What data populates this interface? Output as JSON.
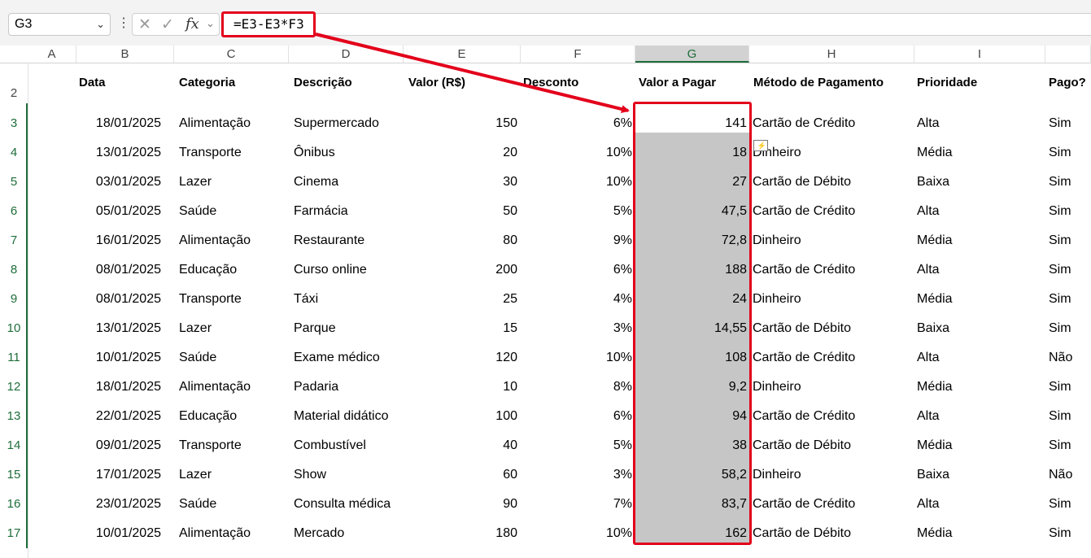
{
  "formula_bar": {
    "name_box": "G3",
    "name_box_dropdown": "⌄",
    "dots": "⋮",
    "cancel_icon": "✕",
    "enter_icon": "✓",
    "fx_label": "fx",
    "fx_dropdown": "⌄",
    "formula": "=E3-E3*F3",
    "highlight_color": "#e3001b"
  },
  "column_headers": [
    "A",
    "B",
    "C",
    "D",
    "E",
    "F",
    "G",
    "H",
    "I"
  ],
  "selected_column": "G",
  "row_numbers": [
    "2",
    "3",
    "4",
    "5",
    "6",
    "7",
    "8",
    "9",
    "10",
    "11",
    "12",
    "13",
    "14",
    "15",
    "16",
    "17"
  ],
  "table": {
    "headers": [
      "Data",
      "Categoria",
      "Descrição",
      "Valor (R$)",
      "Desconto",
      "Valor a Pagar",
      "Método de Pagamento",
      "Prioridade",
      "Pago?"
    ],
    "rows": [
      [
        "18/01/2025",
        "Alimentação",
        "Supermercado",
        "150",
        "6%",
        "141",
        "Cartão de Crédito",
        "Alta",
        "Sim"
      ],
      [
        "13/01/2025",
        "Transporte",
        "Ônibus",
        "20",
        "10%",
        "18",
        "Dinheiro",
        "Média",
        "Sim"
      ],
      [
        "03/01/2025",
        "Lazer",
        "Cinema",
        "30",
        "10%",
        "27",
        "Cartão de Débito",
        "Baixa",
        "Sim"
      ],
      [
        "05/01/2025",
        "Saúde",
        "Farmácia",
        "50",
        "5%",
        "47,5",
        "Cartão de Crédito",
        "Alta",
        "Sim"
      ],
      [
        "16/01/2025",
        "Alimentação",
        "Restaurante",
        "80",
        "9%",
        "72,8",
        "Dinheiro",
        "Média",
        "Sim"
      ],
      [
        "08/01/2025",
        "Educação",
        "Curso online",
        "200",
        "6%",
        "188",
        "Cartão de Crédito",
        "Alta",
        "Sim"
      ],
      [
        "08/01/2025",
        "Transporte",
        "Táxi",
        "25",
        "4%",
        "24",
        "Dinheiro",
        "Média",
        "Sim"
      ],
      [
        "13/01/2025",
        "Lazer",
        "Parque",
        "15",
        "3%",
        "14,55",
        "Cartão de Débito",
        "Baixa",
        "Sim"
      ],
      [
        "10/01/2025",
        "Saúde",
        "Exame médico",
        "120",
        "10%",
        "108",
        "Cartão de Crédito",
        "Alta",
        "Não"
      ],
      [
        "18/01/2025",
        "Alimentação",
        "Padaria",
        "10",
        "8%",
        "9,2",
        "Dinheiro",
        "Média",
        "Sim"
      ],
      [
        "22/01/2025",
        "Educação",
        "Material didático",
        "100",
        "6%",
        "94",
        "Cartão de Crédito",
        "Alta",
        "Sim"
      ],
      [
        "09/01/2025",
        "Transporte",
        "Combustível",
        "40",
        "5%",
        "38",
        "Cartão de Débito",
        "Média",
        "Sim"
      ],
      [
        "17/01/2025",
        "Lazer",
        "Show",
        "60",
        "3%",
        "58,2",
        "Dinheiro",
        "Baixa",
        "Não"
      ],
      [
        "23/01/2025",
        "Saúde",
        "Consulta médica",
        "90",
        "7%",
        "83,7",
        "Cartão de Crédito",
        "Alta",
        "Sim"
      ],
      [
        "10/01/2025",
        "Alimentação",
        "Mercado",
        "180",
        "10%",
        "162",
        "Cartão de Débito",
        "Média",
        "Sim"
      ]
    ]
  },
  "colors": {
    "accent_green": "#1e6d3a",
    "selection_fill": "#c6c6c6",
    "annotation_red": "#e3001b"
  }
}
